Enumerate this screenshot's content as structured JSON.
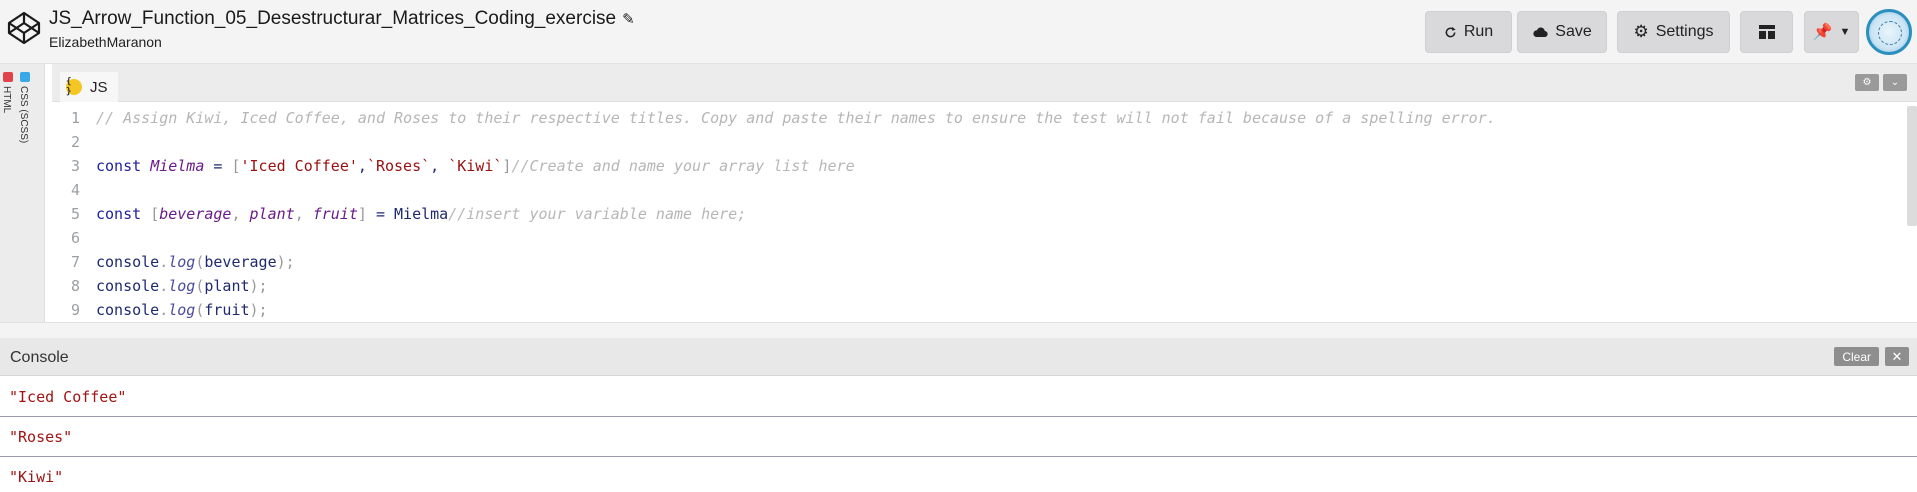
{
  "header": {
    "title": "JS_Arrow_Function_05_Desestructurar_Matrices_Coding_exercise",
    "author": "ElizabethMaranon",
    "buttons": {
      "run": "Run",
      "save": "Save",
      "settings": "Settings"
    }
  },
  "rail": {
    "html_label": "HTML",
    "css_label": "CSS (SCSS)",
    "html_color": "#e0434a",
    "css_color": "#3aa9e8"
  },
  "editor": {
    "tab_label": "JS",
    "badge": "{ }",
    "lines": [
      {
        "num": "1",
        "tokens": [
          {
            "t": "// Assign Kiwi, Iced Coffee, and Roses to their respective titles. Copy and paste their names to ensure the test will not fail because of a spelling error.",
            "k": "comment"
          }
        ]
      },
      {
        "num": "2",
        "tokens": []
      },
      {
        "num": "3",
        "tokens": [
          {
            "t": "const ",
            "k": "kw"
          },
          {
            "t": "Mielma",
            "k": "var"
          },
          {
            "t": " = ",
            "k": "def"
          },
          {
            "t": "[",
            "k": "punc"
          },
          {
            "t": "'Iced Coffee'",
            "k": "str"
          },
          {
            "t": ",",
            "k": "def"
          },
          {
            "t": "`Roses`",
            "k": "str"
          },
          {
            "t": ", ",
            "k": "def"
          },
          {
            "t": "`Kiwi`",
            "k": "str"
          },
          {
            "t": "]",
            "k": "punc"
          },
          {
            "t": "//Create and name your array list here",
            "k": "comment"
          }
        ]
      },
      {
        "num": "4",
        "tokens": []
      },
      {
        "num": "5",
        "tokens": [
          {
            "t": "const ",
            "k": "kw"
          },
          {
            "t": "[",
            "k": "punc"
          },
          {
            "t": "beverage",
            "k": "var"
          },
          {
            "t": ", ",
            "k": "punc"
          },
          {
            "t": "plant",
            "k": "var"
          },
          {
            "t": ", ",
            "k": "punc"
          },
          {
            "t": "fruit",
            "k": "var"
          },
          {
            "t": "]",
            "k": "punc"
          },
          {
            "t": " = ",
            "k": "def"
          },
          {
            "t": "Mielma",
            "k": "def"
          },
          {
            "t": "//insert your variable name here;",
            "k": "comment"
          }
        ]
      },
      {
        "num": "6",
        "tokens": []
      },
      {
        "num": "7",
        "tokens": [
          {
            "t": "console",
            "k": "def"
          },
          {
            "t": ".",
            "k": "punc"
          },
          {
            "t": "log",
            "k": "prop"
          },
          {
            "t": "(",
            "k": "punc"
          },
          {
            "t": "beverage",
            "k": "def"
          },
          {
            "t": ");",
            "k": "punc"
          }
        ]
      },
      {
        "num": "8",
        "tokens": [
          {
            "t": "console",
            "k": "def"
          },
          {
            "t": ".",
            "k": "punc"
          },
          {
            "t": "log",
            "k": "prop"
          },
          {
            "t": "(",
            "k": "punc"
          },
          {
            "t": "plant",
            "k": "def"
          },
          {
            "t": ");",
            "k": "punc"
          }
        ]
      },
      {
        "num": "9",
        "tokens": [
          {
            "t": "console",
            "k": "def"
          },
          {
            "t": ".",
            "k": "punc"
          },
          {
            "t": "log",
            "k": "prop"
          },
          {
            "t": "(",
            "k": "punc"
          },
          {
            "t": "fruit",
            "k": "def"
          },
          {
            "t": ");",
            "k": "punc"
          }
        ]
      }
    ]
  },
  "console": {
    "title": "Console",
    "clear_label": "Clear",
    "close_label": "✕",
    "outputs": [
      "\"Iced Coffee\"",
      "\"Roses\"",
      "\"Kiwi\""
    ]
  },
  "colors": {
    "string": "#9a1010",
    "keyword": "#1f1f9e",
    "variable": "#6a1a8a",
    "comment": "#b6b6b6"
  }
}
